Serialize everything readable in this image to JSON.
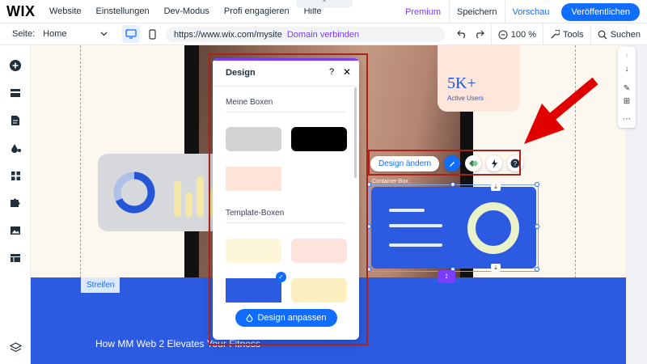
{
  "topbar": {
    "logo": "WIX",
    "menu": [
      "Website",
      "Einstellungen",
      "Dev-Modus",
      "Profi engagieren",
      "Hilfe"
    ],
    "premium": "Premium",
    "save": "Speichern",
    "preview": "Vorschau",
    "publish": "Veröffentlichen"
  },
  "bar2": {
    "page_label": "Seite:",
    "page_value": "Home",
    "url": "https://www.wix.com/mysite",
    "connect_domain": "Domain verbinden",
    "zoom": "100 %",
    "tools": "Tools",
    "search": "Suchen"
  },
  "canvas": {
    "stat_big": "5K+",
    "stat_small": "Active Users",
    "strip_label": "Streifen",
    "band_title": "How MM Web 2 Elevates Your Fitness",
    "container_label": "Container-Box"
  },
  "float_toolbar": {
    "design_change": "Design ändern"
  },
  "panel": {
    "title": "Design",
    "section_my_boxes": "Meine Boxen",
    "section_template_boxes": "Template-Boxen",
    "customize": "Design anpassen"
  },
  "colors": {
    "accent": "#116dff",
    "purple": "#7a3cff",
    "brand_blue": "#2c5ae0",
    "highlight_red": "#a8231b"
  }
}
